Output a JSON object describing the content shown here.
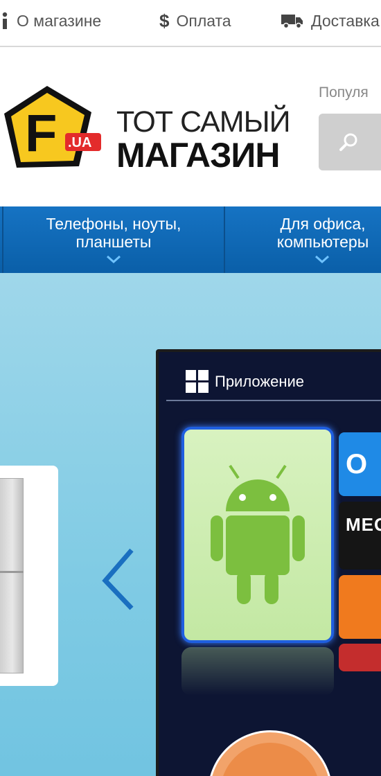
{
  "topbar": {
    "items": [
      {
        "icon": "info-icon",
        "label": "О магазине"
      },
      {
        "icon": "dollar-icon",
        "label": "Оплата"
      },
      {
        "icon": "truck-icon",
        "label": "Доставка"
      }
    ]
  },
  "header": {
    "logo": {
      "badge_letter": "F",
      "badge_suffix": ".UA",
      "line1": "ТОТ САМЫЙ",
      "line2": "МАГАЗИН"
    },
    "popular_label": "Популя",
    "search_icon": "search-icon"
  },
  "nav": {
    "items": [
      {
        "label_line1": "Телефоны, ноуты,",
        "label_line2": "планшеты"
      },
      {
        "label_line1": "Для офиса,",
        "label_line2": "компьютеры"
      }
    ]
  },
  "banner": {
    "tv_screen_title": "Приложение",
    "tiles": [
      "O",
      "MEG"
    ],
    "colors": {
      "nav": "#1673c3",
      "banner": "#80cbe4",
      "badge": "#f5c518"
    }
  }
}
